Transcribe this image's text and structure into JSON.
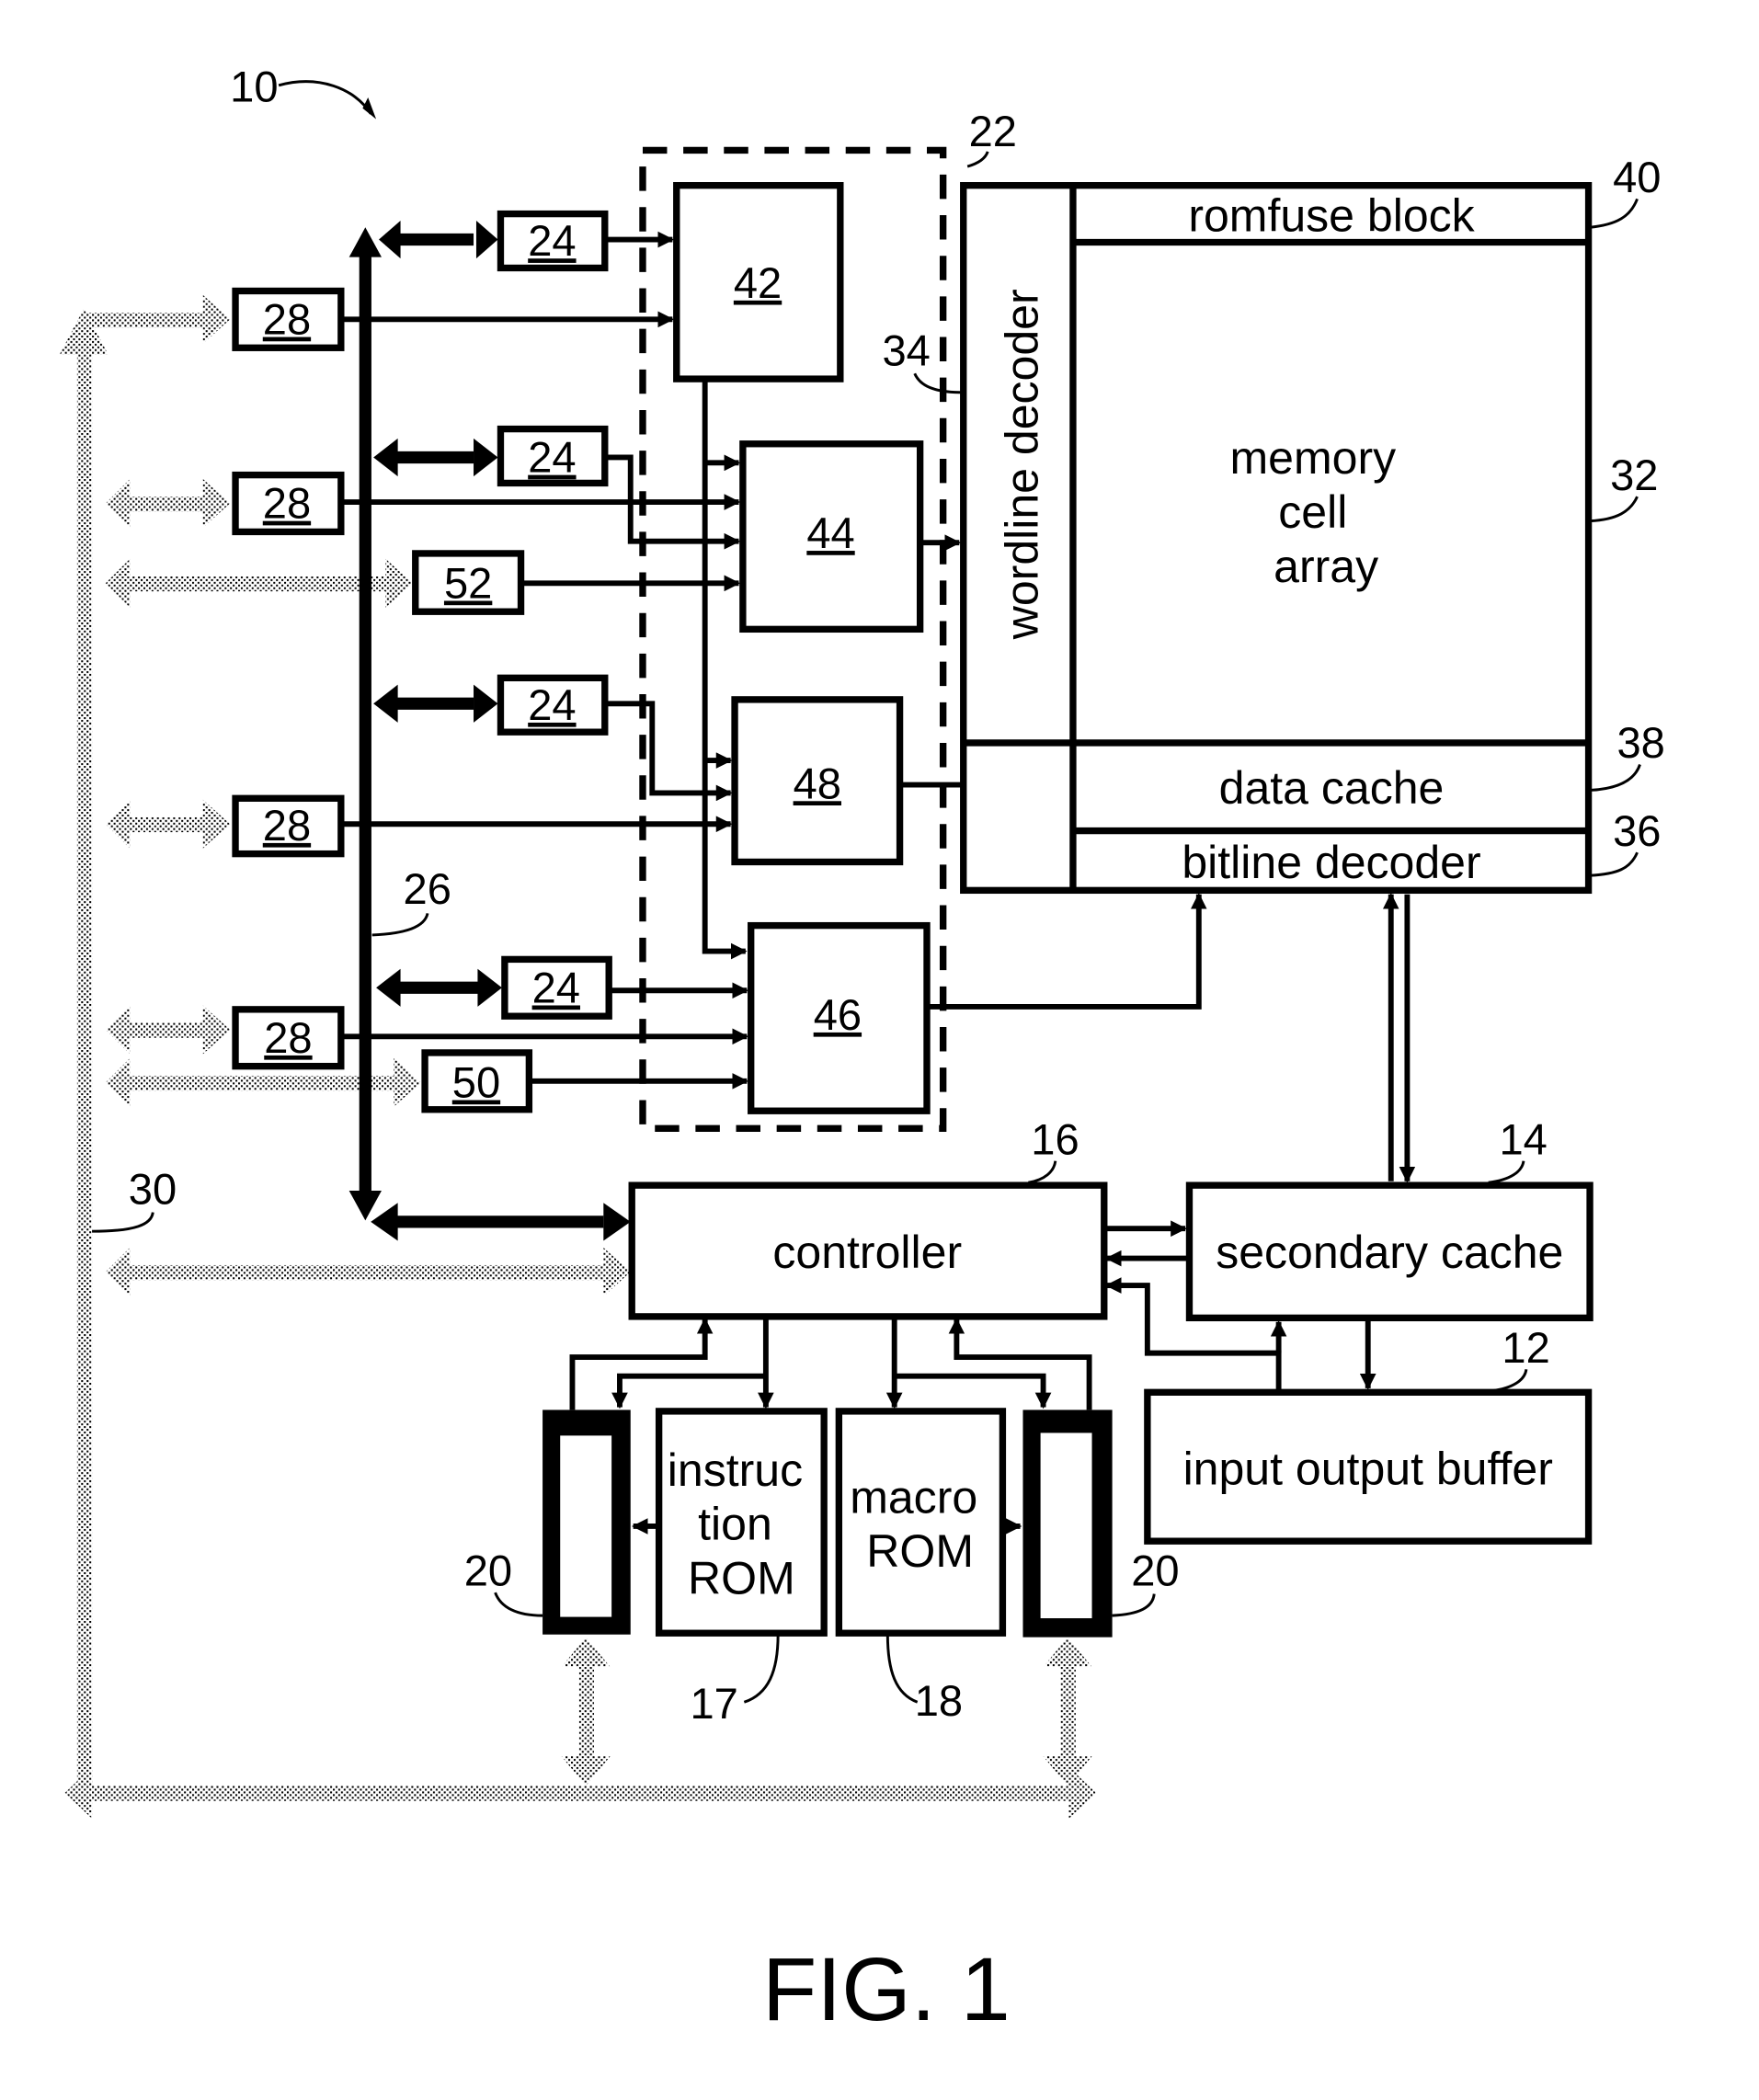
{
  "figure": {
    "caption": "FIG. 1",
    "reference_numerals": {
      "system": "10",
      "io_buffer": "12",
      "secondary_cache": "14",
      "controller": "16",
      "instruction_rom": "17",
      "macro_rom": "18",
      "register": "20",
      "dashed_group": "22",
      "block_24": "24",
      "bus_26": "26",
      "block_28": "28",
      "bus_30": "30",
      "memory_cell_array": "32",
      "wordline_decoder": "34",
      "bitline_decoder": "36",
      "data_cache": "38",
      "romfuse_block": "40",
      "block_42": "42",
      "block_44": "44",
      "block_46": "46",
      "block_48": "48",
      "block_50": "50",
      "block_52": "52"
    },
    "blocks": {
      "romfuse_block": "romfuse block",
      "memory_cell_array": [
        "memory",
        "cell",
        "array"
      ],
      "wordline_decoder": "wordline decoder",
      "data_cache": "data cache",
      "bitline_decoder": "bitline decoder",
      "controller": "controller",
      "secondary_cache": "secondary cache",
      "io_buffer": "input output buffer",
      "instruction_rom": [
        "instruc",
        "tion",
        "ROM"
      ],
      "macro_rom": [
        "macro",
        "ROM"
      ]
    }
  }
}
